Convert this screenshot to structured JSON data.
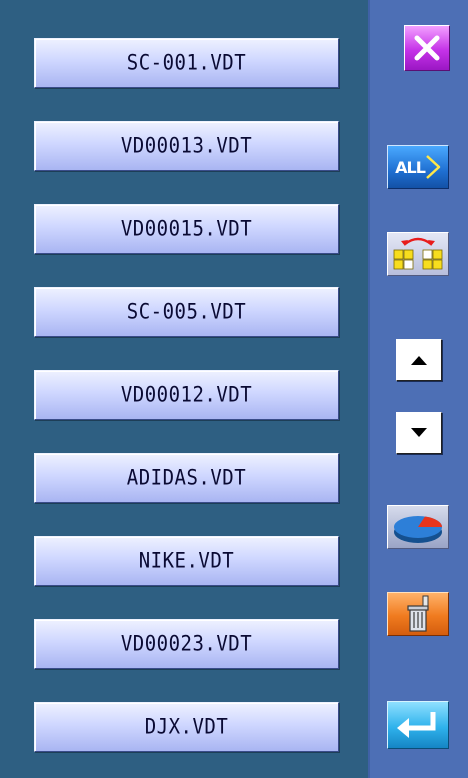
{
  "files": [
    "SC-001.VDT",
    "VD00013.VDT",
    "VD00015.VDT",
    "SC-005.VDT",
    "VD00012.VDT",
    "ADIDAS.VDT",
    "NIKE.VDT",
    "VD00023.VDT",
    "DJX.VDT"
  ],
  "toolbar": {
    "all_label": "ALL",
    "icons": {
      "close": "close-icon",
      "all": "select-all-icon",
      "swap": "swap-icon",
      "up": "arrow-up-icon",
      "down": "arrow-down-icon",
      "pie": "pie-chart-icon",
      "delete": "trash-icon",
      "enter": "enter-icon"
    }
  },
  "colors": {
    "panel_bg": "#2e5f82",
    "toolbar_bg": "#4d6fb5",
    "file_button": "#c9d2ff",
    "close": "#c533e8",
    "all": "#1f6fd1",
    "delete": "#f07b1f",
    "enter": "#2fb2ec"
  }
}
